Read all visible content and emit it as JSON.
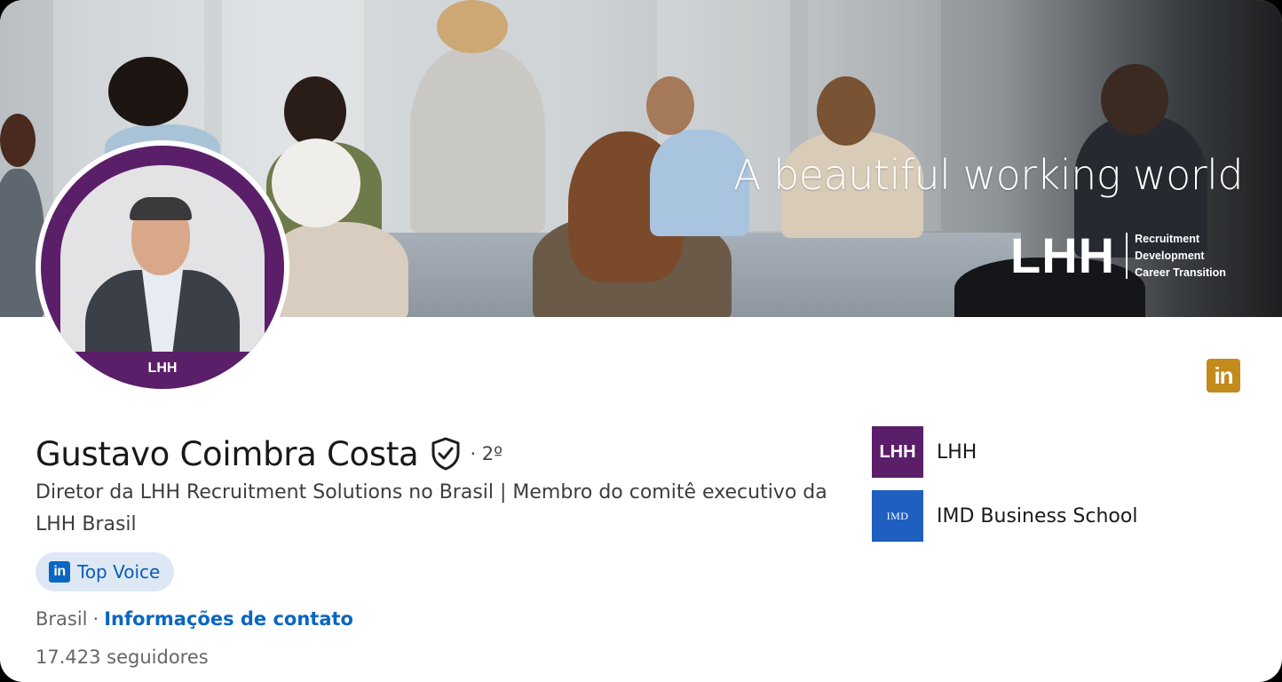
{
  "banner": {
    "tagline": "A beautiful working world",
    "logo_word": "LHH",
    "logo_lines": [
      "Recruitment",
      "Development",
      "Career Transition"
    ]
  },
  "avatar": {
    "label": "LHH"
  },
  "corner_icon": "linkedin-icon",
  "profile": {
    "name": "Gustavo Coimbra Costa",
    "degree": "· 2º",
    "headline": "Diretor da LHH Recruitment Solutions no Brasil | Membro do comitê executivo da LHH Brasil",
    "badge_label": "Top Voice",
    "location": "Brasil",
    "separator": "·",
    "contact_link": "Informações de contato",
    "followers": "17.423 seguidores"
  },
  "organizations": [
    {
      "logo_text": "LHH",
      "name": "LHH"
    },
    {
      "logo_text": "IMD",
      "name": "IMD Business School"
    }
  ],
  "colors": {
    "brand_purple": "#5b1f69",
    "linkedin_blue": "#0a66c2",
    "badge_bg": "#dde8f4",
    "corner_icon": "#c38a1c"
  }
}
